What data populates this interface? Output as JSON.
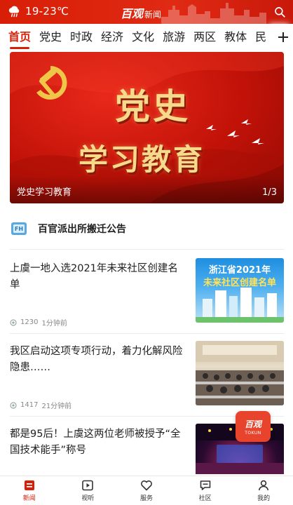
{
  "header": {
    "weather_icon": "cloud-rain-icon",
    "temperature": "19-23℃",
    "brand": "百观",
    "brand_sub": "新闻",
    "search_icon": "search-icon"
  },
  "tabs": {
    "items": [
      {
        "label": "首页",
        "active": true
      },
      {
        "label": "党史"
      },
      {
        "label": "时政"
      },
      {
        "label": "经济"
      },
      {
        "label": "文化"
      },
      {
        "label": "旅游"
      },
      {
        "label": "两区"
      },
      {
        "label": "教体"
      },
      {
        "label": "民"
      }
    ],
    "more_icon": "plus-icon"
  },
  "banner": {
    "title_line1": "党史",
    "title_line2": "学习教育",
    "caption": "党史学习教育",
    "pager": "1/3"
  },
  "notice": {
    "title": "百官派出所搬迁公告"
  },
  "news": [
    {
      "title": "上虞一地入选2021年未来社区创建名单",
      "views": "1230",
      "time": "1分钟前",
      "thumb_line1": "浙江省2021年",
      "thumb_line2": "未来社区创建名单"
    },
    {
      "title": "我区启动这项专项行动，着力化解风险隐患……",
      "views": "1417",
      "time": "21分钟前"
    },
    {
      "title": "都是95后！上虞这两位老师被授予“全国技术能手”称号"
    }
  ],
  "float_badge": {
    "label": "百观",
    "sub": "TOKUN"
  },
  "bottom_nav": [
    {
      "label": "新闻",
      "icon": "news-icon",
      "active": true
    },
    {
      "label": "视听",
      "icon": "video-icon"
    },
    {
      "label": "服务",
      "icon": "service-icon"
    },
    {
      "label": "社区",
      "icon": "chat-icon"
    },
    {
      "label": "我的",
      "icon": "user-icon"
    }
  ],
  "colors": {
    "brand_red": "#d81e06",
    "banner_gold": "#f6d98a"
  }
}
